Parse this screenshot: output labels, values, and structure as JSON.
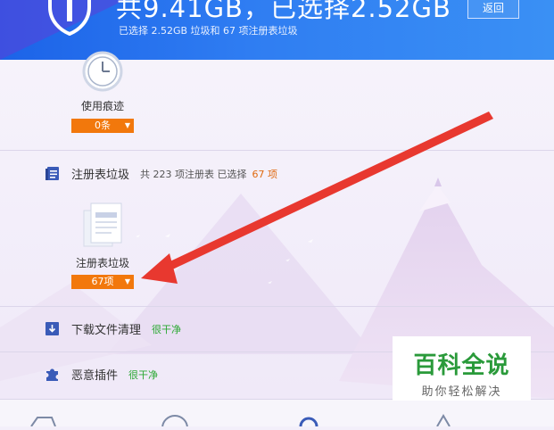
{
  "header": {
    "big_title": "共9.41GB，已选择2.52GB",
    "sub_title": "已选择 2.52GB 垃圾和 67 项注册表垃圾",
    "back_label": "返回"
  },
  "usage_traces": {
    "label": "使用痕迹",
    "count_label": "0条"
  },
  "registry": {
    "title": "注册表垃圾",
    "info_prefix": "共 223 项注册表 已选择",
    "selected_count": "67 项",
    "card_label": "注册表垃圾",
    "card_count": "67项"
  },
  "download": {
    "title": "下载文件清理",
    "status": "很干净"
  },
  "plugins": {
    "title": "恶意插件",
    "status": "很干净"
  },
  "watermark": {
    "main": "百科全说",
    "sub": "助你轻松解决"
  },
  "colors": {
    "accent_orange": "#f2780c",
    "header_blue": "#2f7df2",
    "clean_green": "#2aa832",
    "arrow_red": "#e8382f"
  }
}
